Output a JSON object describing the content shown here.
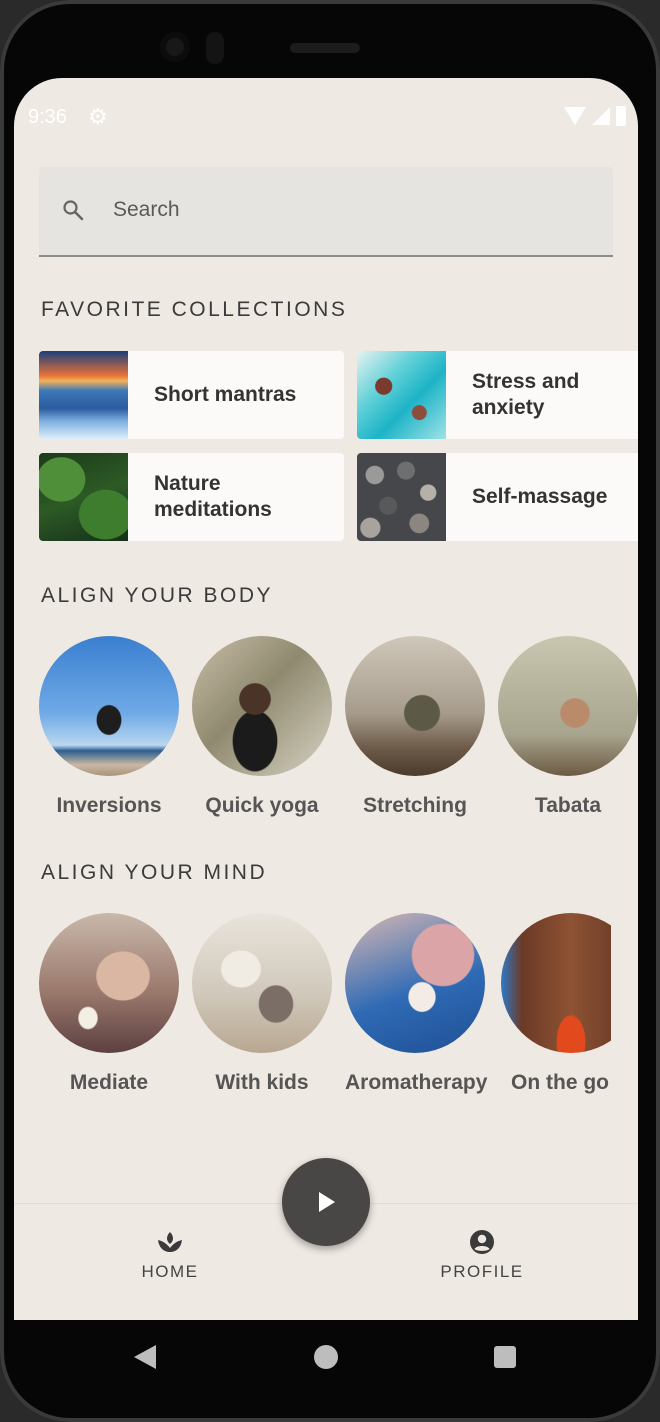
{
  "status_bar": {
    "time": "9:36",
    "settings_icon": "gear-icon",
    "icons": [
      "wifi-icon",
      "signal-icon",
      "battery-icon"
    ]
  },
  "search": {
    "placeholder": "Search",
    "icon": "search-icon"
  },
  "favorites": {
    "title": "FAVORITE COLLECTIONS",
    "items": [
      {
        "label": "Short mantras"
      },
      {
        "label": "Stress and anxiety"
      },
      {
        "label": "Nature meditations"
      },
      {
        "label": "Self-massage"
      }
    ]
  },
  "body_section": {
    "title": "ALIGN YOUR BODY",
    "items": [
      {
        "label": "Inversions"
      },
      {
        "label": "Quick yoga"
      },
      {
        "label": "Stretching"
      },
      {
        "label": "Tabata"
      }
    ]
  },
  "mind_section": {
    "title": "ALIGN YOUR MIND",
    "items": [
      {
        "label": "Mediate"
      },
      {
        "label": "With kids"
      },
      {
        "label": "Aromatherapy"
      },
      {
        "label": "On the go"
      }
    ]
  },
  "bottom_nav": {
    "home_label": "HOME",
    "home_icon": "spa-icon",
    "profile_label": "PROFILE",
    "profile_icon": "account-circle-icon",
    "fab_icon": "play-icon"
  },
  "system_nav": [
    "back-icon",
    "home-circle-icon",
    "recents-icon"
  ]
}
